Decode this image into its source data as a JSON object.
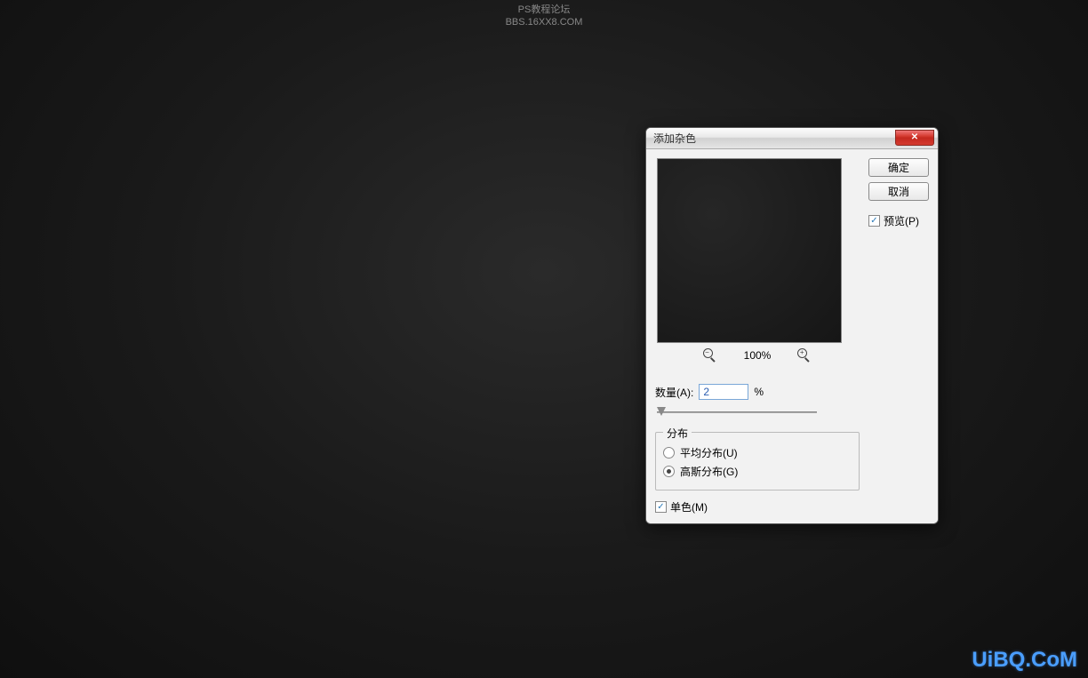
{
  "watermark": {
    "line1": "PS教程论坛",
    "line2": "BBS.16XX8.COM",
    "bottom": "UiBQ.CoM"
  },
  "dialog": {
    "title": "添加杂色",
    "close": "✕",
    "ok": "确定",
    "cancel": "取消",
    "preview_label": "预览(P)",
    "zoom_level": "100%",
    "amount_label": "数量(A):",
    "amount_value": "2",
    "amount_unit": "%",
    "distribution": {
      "legend": "分布",
      "uniform": "平均分布(U)",
      "gaussian": "高斯分布(G)",
      "selected": "gaussian"
    },
    "monochromatic": "单色(M)",
    "preview_checked": true,
    "mono_checked": true
  }
}
